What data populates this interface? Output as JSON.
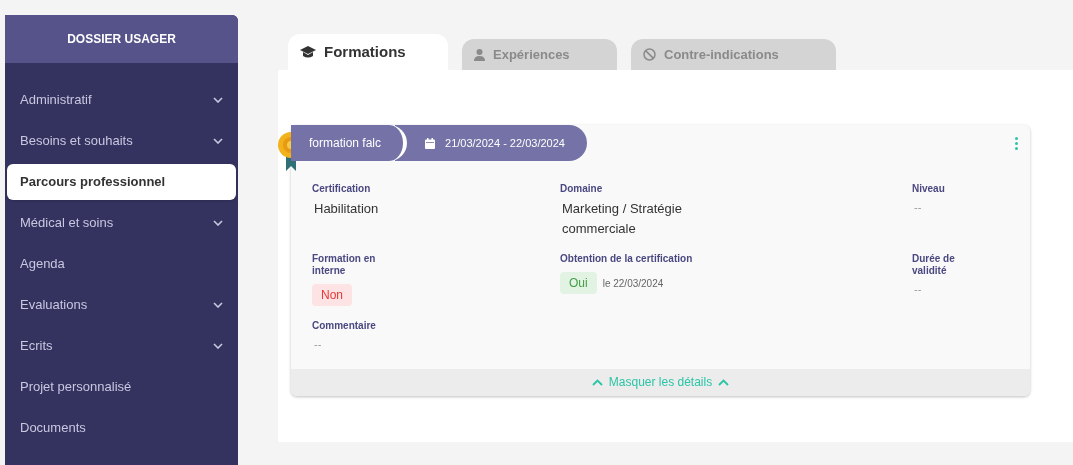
{
  "sidebar": {
    "header": "DOSSIER USAGER",
    "items": [
      {
        "label": "Administratif",
        "expandable": true,
        "selected": false
      },
      {
        "label": "Besoins et souhaits",
        "expandable": true,
        "selected": false
      },
      {
        "label": "Parcours professionnel",
        "expandable": false,
        "selected": true
      },
      {
        "label": "Médical et soins",
        "expandable": true,
        "selected": false
      },
      {
        "label": "Agenda",
        "expandable": false,
        "selected": false
      },
      {
        "label": "Evaluations",
        "expandable": true,
        "selected": false
      },
      {
        "label": "Ecrits",
        "expandable": true,
        "selected": false
      },
      {
        "label": "Projet personnalisé",
        "expandable": false,
        "selected": false
      },
      {
        "label": "Documents",
        "expandable": false,
        "selected": false
      }
    ]
  },
  "tabs": [
    {
      "label": "Formations",
      "selected": true
    },
    {
      "label": "Expériences",
      "selected": false
    },
    {
      "label": "Contre-indications",
      "selected": false
    }
  ],
  "card": {
    "title": "formation falc",
    "dates": "21/03/2024 - 22/03/2024",
    "fields": [
      {
        "label": "Certification",
        "kind": "text",
        "value": "Habilitation"
      },
      {
        "label": "Domaine",
        "kind": "text",
        "value": "Marketing / Stratégie commerciale"
      },
      {
        "label": "Niveau",
        "kind": "empty",
        "value": "--"
      },
      {
        "label": "Formation en interne",
        "kind": "badge",
        "value": "Non",
        "color": "#e53935"
      },
      {
        "label": "Obtention de la certification",
        "kind": "badge",
        "value": "Oui",
        "color": "#43a047",
        "note": "le 22/03/2024"
      },
      {
        "label": "Durée de validité",
        "kind": "empty",
        "value": "--"
      },
      {
        "label": "Commentaire",
        "kind": "empty",
        "value": "--"
      }
    ],
    "toggle": "Masquer les détails"
  }
}
